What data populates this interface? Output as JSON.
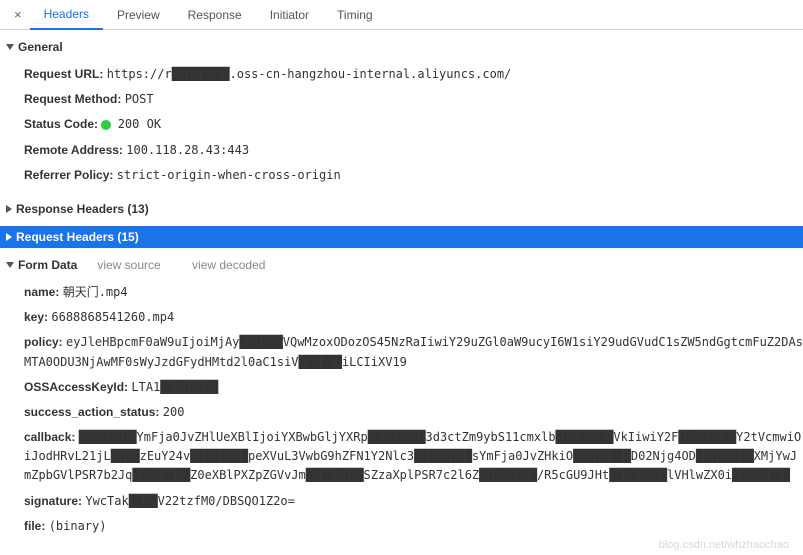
{
  "tabs": {
    "headers": "Headers",
    "preview": "Preview",
    "response": "Response",
    "initiator": "Initiator",
    "timing": "Timing"
  },
  "sections": {
    "general": {
      "title": "General",
      "items": {
        "request_url_label": "Request URL:",
        "request_url_value": "https://r████████.oss-cn-hangzhou-internal.aliyuncs.com/",
        "request_method_label": "Request Method:",
        "request_method_value": "POST",
        "status_code_label": "Status Code:",
        "status_code_value": "200 OK",
        "remote_address_label": "Remote Address:",
        "remote_address_value": "100.118.28.43:443",
        "referrer_policy_label": "Referrer Policy:",
        "referrer_policy_value": "strict-origin-when-cross-origin"
      }
    },
    "response_headers": {
      "title": "Response Headers (13)"
    },
    "request_headers": {
      "title": "Request Headers (15)"
    },
    "form_data": {
      "title": "Form Data",
      "view_source": "view source",
      "view_decoded": "view decoded",
      "items": {
        "name_label": "name:",
        "name_value": "朝天门.mp4",
        "key_label": "key:",
        "key_value": "6688868541260.mp4",
        "policy_label": "policy:",
        "policy_value": "eyJleHBpcmF0aW9uIjoiMjAy██████VQwMzoxODozOS45NzRaIiwiY29uZGl0aW9ucyI6W1siY29udGVudC1sZW5ndGgtcmFuZ2DAsMTA0ODU3NjAwMF0sWyJzdGFydHMtd2l0aC1siV██████iLCIiXV19",
        "oss_key_label": "OSSAccessKeyId:",
        "oss_key_value": "LTA1████████",
        "success_label": "success_action_status:",
        "success_value": "200",
        "callback_label": "callback:",
        "callback_value": "████████YmFja0JvZHlUeXBlIjoiYXBwbGljYXRp████████3d3ctZm9ybS11cmxlb████████VkIiwiY2F████████Y2tVcmwiOiJodHRvL21jL████zEuY24v████████peXVuL3VwbG9hZFN1Y2Nlc3████████sYmFja0JvZHkiO████████D02Njg4OD████████XMjYwJmZpbGVlPSR7b2Jq████████Z0eXBlPXZpZGVvJm████████SZzaXplPSR7c2l6Z████████/R5cGU9JHt████████lVHlwZX0i████████",
        "signature_label": "signature:",
        "signature_value": "YwcTak████V22tzfM0/DBSQO1Z2o=",
        "file_label": "file:",
        "file_value": "(binary)"
      }
    }
  },
  "watermark": "blog.csdn.net/whzhaochao"
}
